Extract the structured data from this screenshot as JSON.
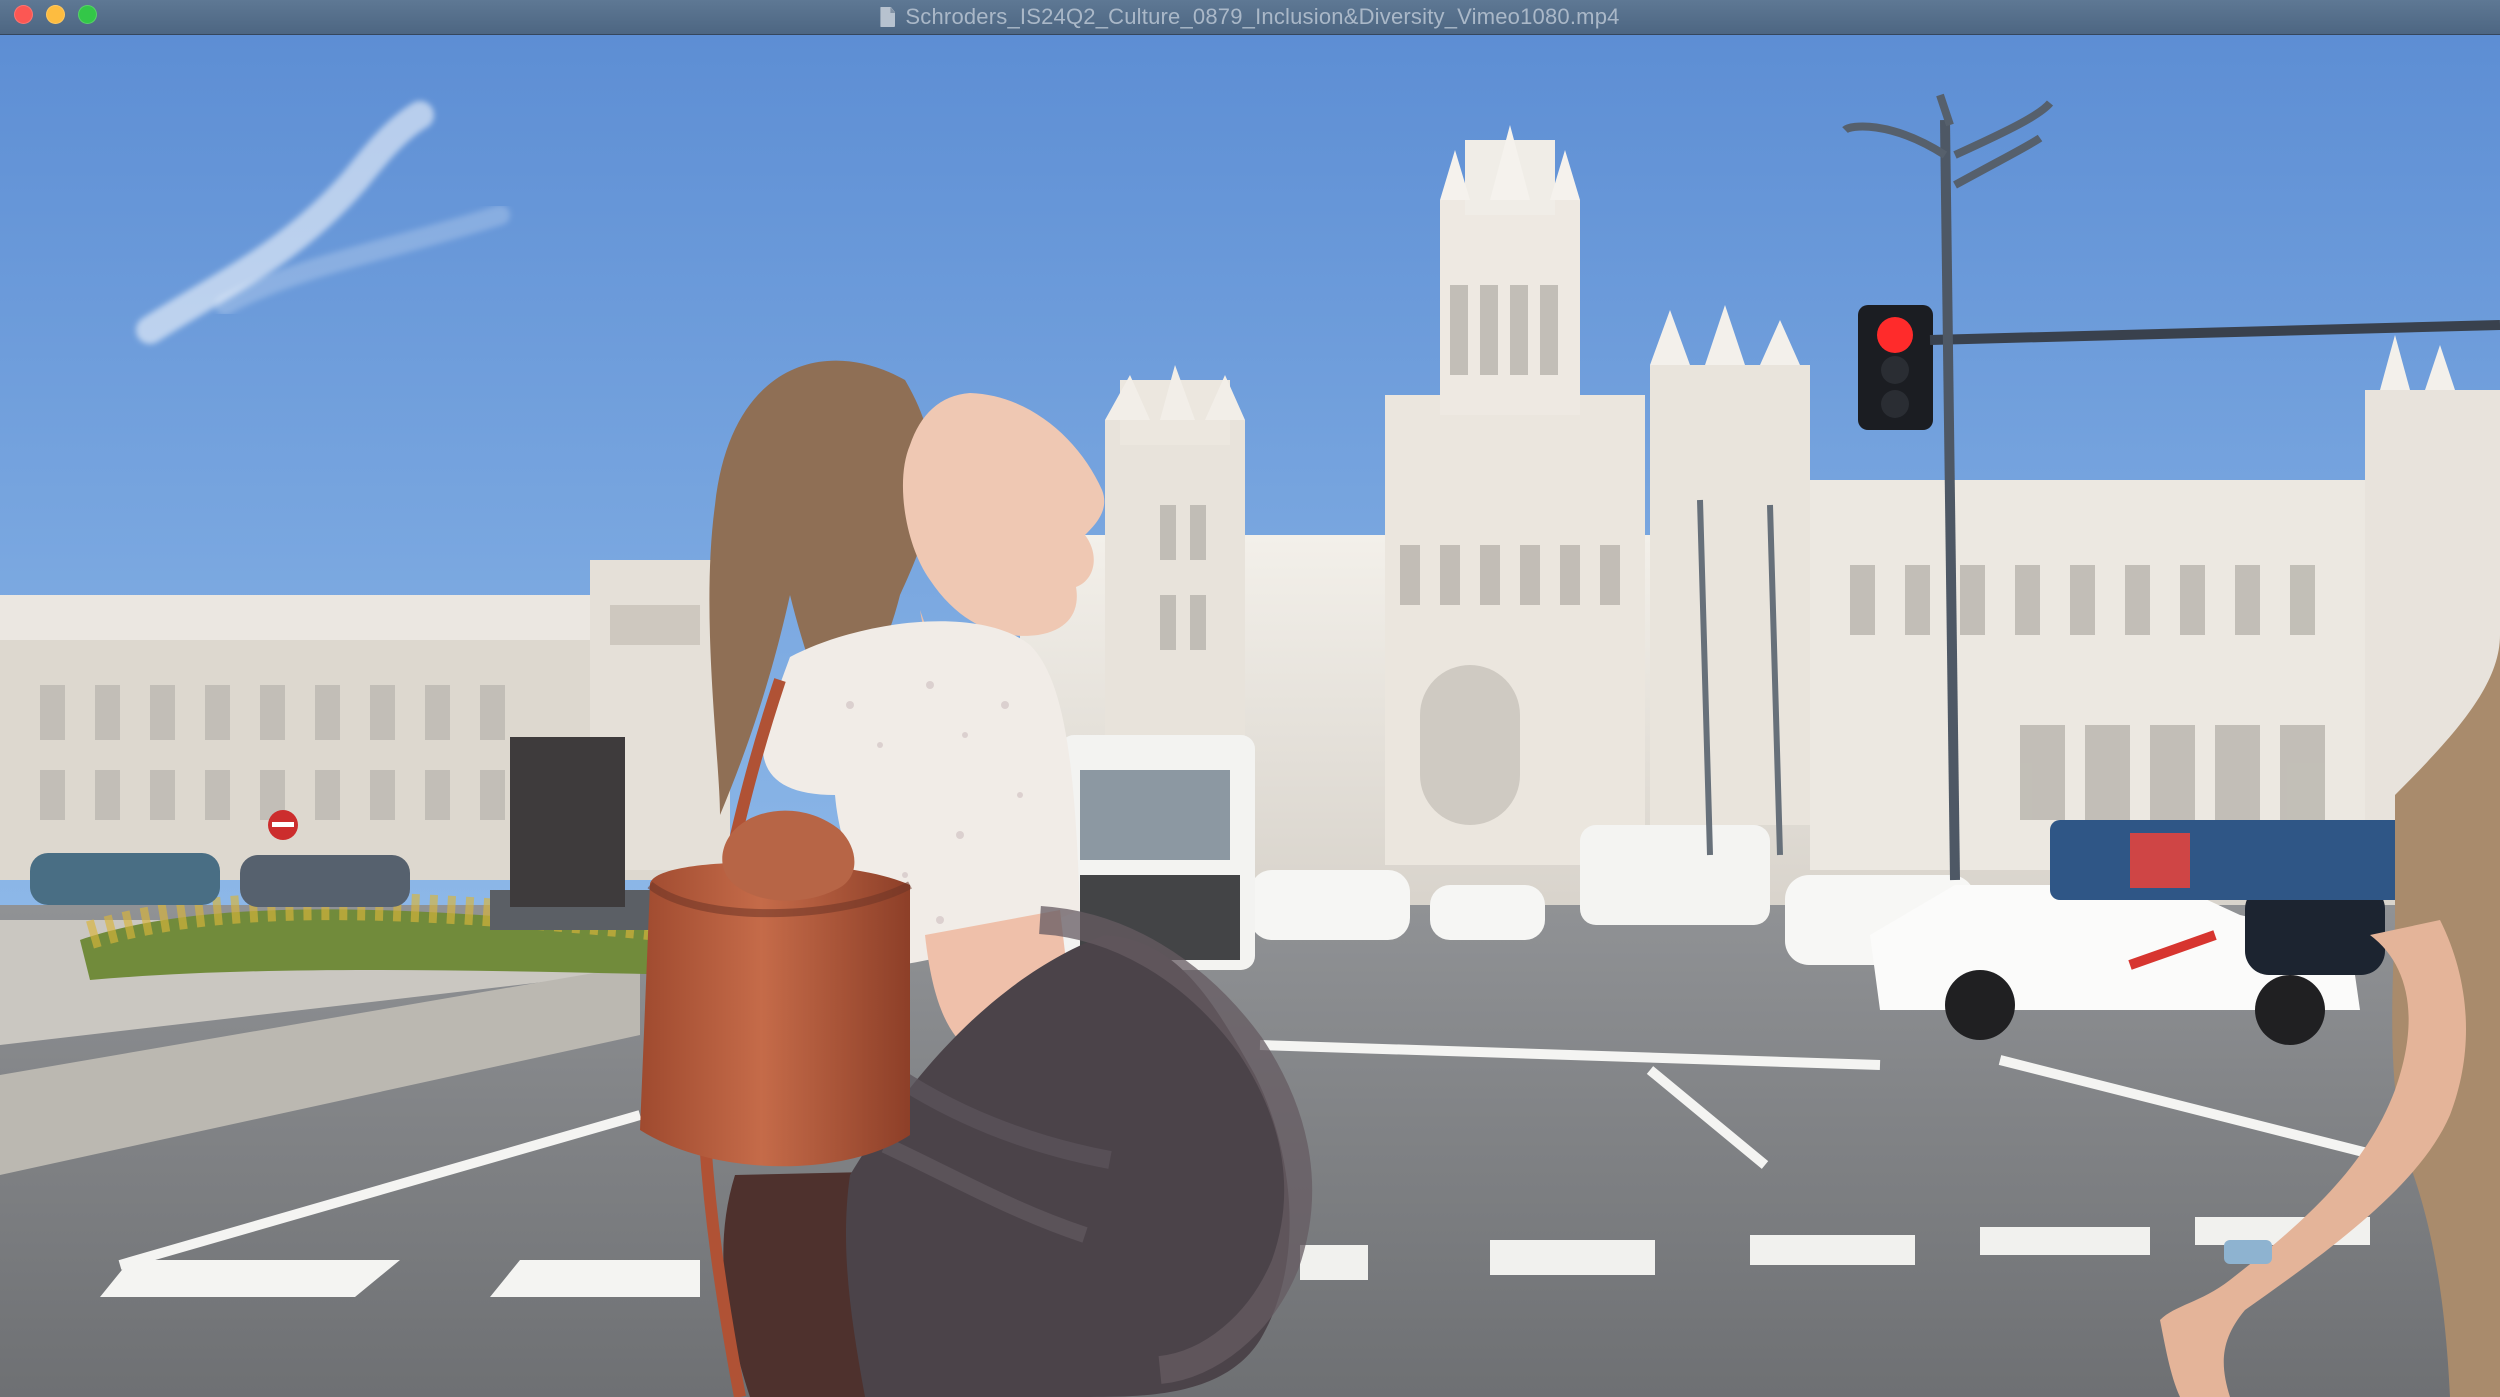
{
  "window": {
    "title": "Schroders_IS24Q2_Culture_0879_Inclusion&Diversity_Vimeo1080.mp4",
    "controls": {
      "close_color": "#fc5753",
      "minimize_color": "#fdbc40",
      "maximize_color": "#33c748"
    },
    "file_icon": "document-icon"
  },
  "video": {
    "description_colors": {
      "sky_top": "#5d8ed4",
      "sky_bottom": "#9cc4eb",
      "building": "#e7e2da",
      "road": "#7f8286",
      "accent_bag": "#b75d3c",
      "traffic_red": "#ff2b2b"
    }
  }
}
